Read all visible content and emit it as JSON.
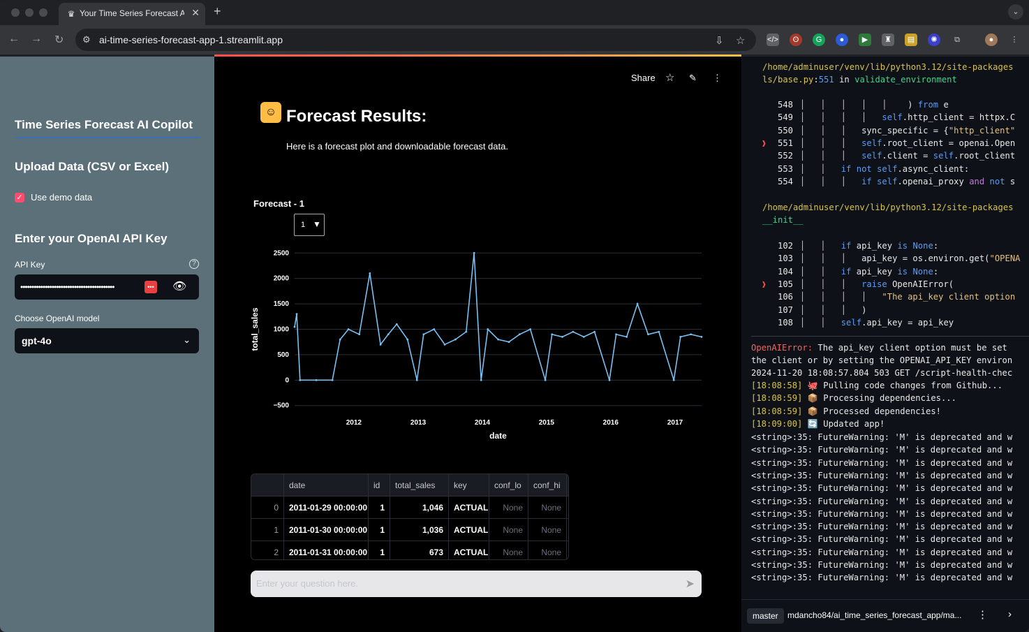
{
  "browser": {
    "tab_title": "Your Time Series Forecast AI",
    "url": "ai-time-series-forecast-app-1.streamlit.app"
  },
  "sidebar": {
    "title": "Time Series Forecast AI Copilot",
    "upload_heading": "Upload Data (CSV or Excel)",
    "use_demo_label": "Use demo data",
    "use_demo_checked": true,
    "api_heading": "Enter your OpenAI API Key",
    "api_key_label": "API Key",
    "api_key_value": "••••••••••••••••••••••••••••••••••••••••••",
    "model_label": "Choose OpenAI model",
    "model_value": "gpt-4o"
  },
  "header": {
    "share_label": "Share"
  },
  "main": {
    "results_title": "Forecast Results:",
    "results_subtitle": "Here is a forecast plot and downloadable forecast data.",
    "plot_title": "Forecast - 1",
    "plot_select_value": "1",
    "chat_placeholder": "Enter your question here.",
    "table": {
      "columns": [
        "",
        "date",
        "id",
        "total_sales",
        "key",
        "conf_lo",
        "conf_hi"
      ],
      "rows": [
        [
          "0",
          "2011-01-29 00:00:00",
          "1",
          "1,046",
          "ACTUAL",
          "None",
          "None"
        ],
        [
          "1",
          "2011-01-30 00:00:00",
          "1",
          "1,036",
          "ACTUAL",
          "None",
          "None"
        ],
        [
          "2",
          "2011-01-31 00:00:00",
          "1",
          "673",
          "ACTUAL",
          "None",
          "None"
        ]
      ]
    }
  },
  "chart_data": {
    "type": "line",
    "title": "Forecast - 1",
    "xlabel": "date",
    "ylabel": "total_sales",
    "x_ticks": [
      "2012",
      "2013",
      "2014",
      "2015",
      "2016",
      "2017"
    ],
    "y_ticks": [
      -500,
      0,
      500,
      1000,
      1500,
      2000,
      2500
    ],
    "xlim": [
      "2011-01-29",
      "2017-06-01"
    ],
    "ylim": [
      -600,
      2600
    ],
    "series": [
      {
        "color": "#79c0f2",
        "x": [
          "2011-01-29",
          "2011-02-10",
          "2011-03-01",
          "2011-06-01",
          "2011-09-01",
          "2011-10-15",
          "2011-12-01",
          "2012-02-01",
          "2012-04-01",
          "2012-06-01",
          "2012-07-15",
          "2012-09-01",
          "2012-11-01",
          "2012-12-25",
          "2013-02-01",
          "2013-04-01",
          "2013-06-01",
          "2013-08-01",
          "2013-10-01",
          "2013-11-15",
          "2013-12-25",
          "2014-02-01",
          "2014-04-01",
          "2014-06-01",
          "2014-08-01",
          "2014-10-01",
          "2014-12-25",
          "2015-02-01",
          "2015-04-01",
          "2015-06-01",
          "2015-08-01",
          "2015-10-01",
          "2015-12-25",
          "2016-02-01",
          "2016-04-01",
          "2016-06-01",
          "2016-08-01",
          "2016-10-01",
          "2016-12-25",
          "2017-02-01",
          "2017-04-01",
          "2017-06-01"
        ],
        "y": [
          1046,
          1300,
          0,
          0,
          0,
          800,
          1000,
          900,
          2100,
          700,
          900,
          1100,
          800,
          0,
          900,
          1000,
          700,
          800,
          950,
          2500,
          0,
          1000,
          800,
          750,
          900,
          1000,
          0,
          900,
          850,
          950,
          850,
          950,
          0,
          900,
          850,
          1500,
          900,
          950,
          0,
          850,
          900,
          850
        ]
      }
    ],
    "grid": true,
    "legend": "none"
  },
  "logs": {
    "path1a": "/home/adminuser/venv/lib/python3.12/site-packages",
    "path1b": "ls/base.py",
    "path1_line": "551",
    "path1_in": "in",
    "path1_func": "validate_environment",
    "block1": [
      {
        "n": "548",
        "marker": false,
        "guides": "│   │   │   │   │ ",
        "code": "   ) from e"
      },
      {
        "n": "549",
        "marker": false,
        "guides": "│   │   │   │   ",
        "code": "self.http_client = httpx.C"
      },
      {
        "n": "550",
        "marker": false,
        "guides": "│   │   │   ",
        "code": "sync_specific = {\"http_client\""
      },
      {
        "n": "551",
        "marker": true,
        "guides": "│   │   │   ",
        "code": "self.root_client = openai.Open"
      },
      {
        "n": "552",
        "marker": false,
        "guides": "│   │   │   ",
        "code": "self.client = self.root_client"
      },
      {
        "n": "553",
        "marker": false,
        "guides": "│   │   ",
        "code": "if not self.async_client:"
      },
      {
        "n": "554",
        "marker": false,
        "guides": "│   │   │   ",
        "code": "if self.openai_proxy and not s"
      }
    ],
    "path2a": "/home/adminuser/venv/lib/python3.12/site-packages",
    "path2b": "__init__",
    "block2": [
      {
        "n": "102",
        "marker": false,
        "guides": "│   │   ",
        "code": "if api_key is None:"
      },
      {
        "n": "103",
        "marker": false,
        "guides": "│   │   │   ",
        "code": "api_key = os.environ.get(\"OPENA"
      },
      {
        "n": "104",
        "marker": false,
        "guides": "│   │   ",
        "code": "if api_key is None:"
      },
      {
        "n": "105",
        "marker": true,
        "guides": "│   │   │   ",
        "code": "raise OpenAIError("
      },
      {
        "n": "106",
        "marker": false,
        "guides": "│   │   │   │   ",
        "code": "\"The api_key client option"
      },
      {
        "n": "107",
        "marker": false,
        "guides": "│   │   │   ",
        "code": ")"
      },
      {
        "n": "108",
        "marker": false,
        "guides": "│   │   ",
        "code": "self.api_key = api_key"
      }
    ],
    "error_name": "OpenAIError:",
    "error_msg": " The api_key client option must be set",
    "lines": [
      "the client or by setting the OPENAI_API_KEY environ",
      "2024-11-20 18:08:57.804 503 GET /script-health-chec"
    ],
    "status": [
      {
        "time": "[18:08:58]",
        "icon": "🐙",
        "text": " Pulling code changes from Github..."
      },
      {
        "time": "[18:08:59]",
        "icon": "📦",
        "text": " Processing dependencies..."
      },
      {
        "time": "[18:08:59]",
        "icon": "📦",
        "text": " Processed dependencies!"
      },
      {
        "time": "[18:09:00]",
        "icon": "🔄",
        "text": " Updated app!"
      }
    ],
    "warning": "<string>:35: FutureWarning: 'M' is deprecated and w",
    "warning_count": 12,
    "branch": "master",
    "repo": "mdancho84/ai_time_series_forecast_app/ma..."
  }
}
